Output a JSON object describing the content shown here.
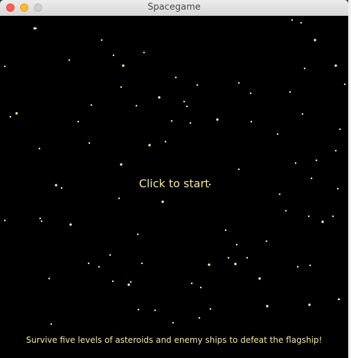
{
  "window": {
    "title": "Spacegame"
  },
  "game": {
    "start_prompt": "Click to start",
    "tagline": "Survive five levels of asteroids and enemy ships to defeat the flagship!"
  },
  "colors": {
    "background": "#000000",
    "star": "#fff4b0",
    "text": "#f5e8a0"
  }
}
